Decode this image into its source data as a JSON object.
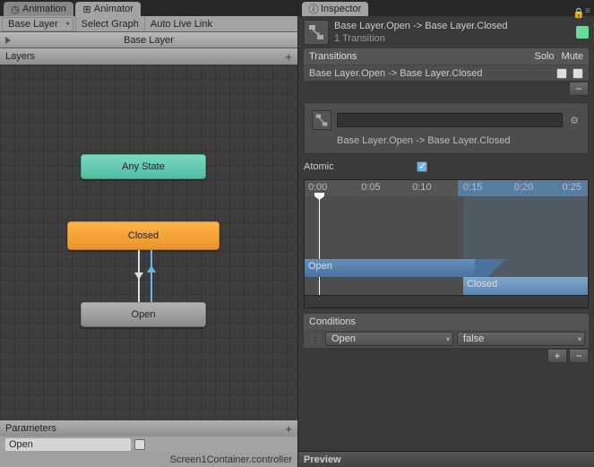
{
  "tabs": {
    "animation": "Animation",
    "animator": "Animator",
    "inspector": "Inspector"
  },
  "toolbar": {
    "base_layer_dd": "Base Layer",
    "select_graph": "Select Graph",
    "auto_live": "Auto Live Link"
  },
  "breadcrumb": {
    "label": "Base Layer"
  },
  "layers": {
    "label": "Layers"
  },
  "graph": {
    "any_state": "Any State",
    "closed": "Closed",
    "open": "Open"
  },
  "parameters": {
    "label": "Parameters",
    "param0": "Open"
  },
  "status": {
    "file": "Screen1Container.controller"
  },
  "inspector": {
    "title": "Base Layer.Open -> Base Layer.Closed",
    "subtitle": "1 Transition",
    "transitions_label": "Transitions",
    "solo": "Solo",
    "mute": "Mute",
    "row0": "Base Layer.Open -> Base Layer.Closed",
    "name_display": "Base Layer.Open -> Base Layer.Closed",
    "atomic_label": "Atomic",
    "timeline": {
      "ticks": [
        "0:00",
        "0:05",
        "0:10",
        "0:15",
        "0:20",
        "0:25"
      ],
      "open_clip": "Open",
      "closed_clip": "Closed"
    },
    "conditions_label": "Conditions",
    "cond_param": "Open",
    "cond_value": "false",
    "preview": "Preview"
  }
}
